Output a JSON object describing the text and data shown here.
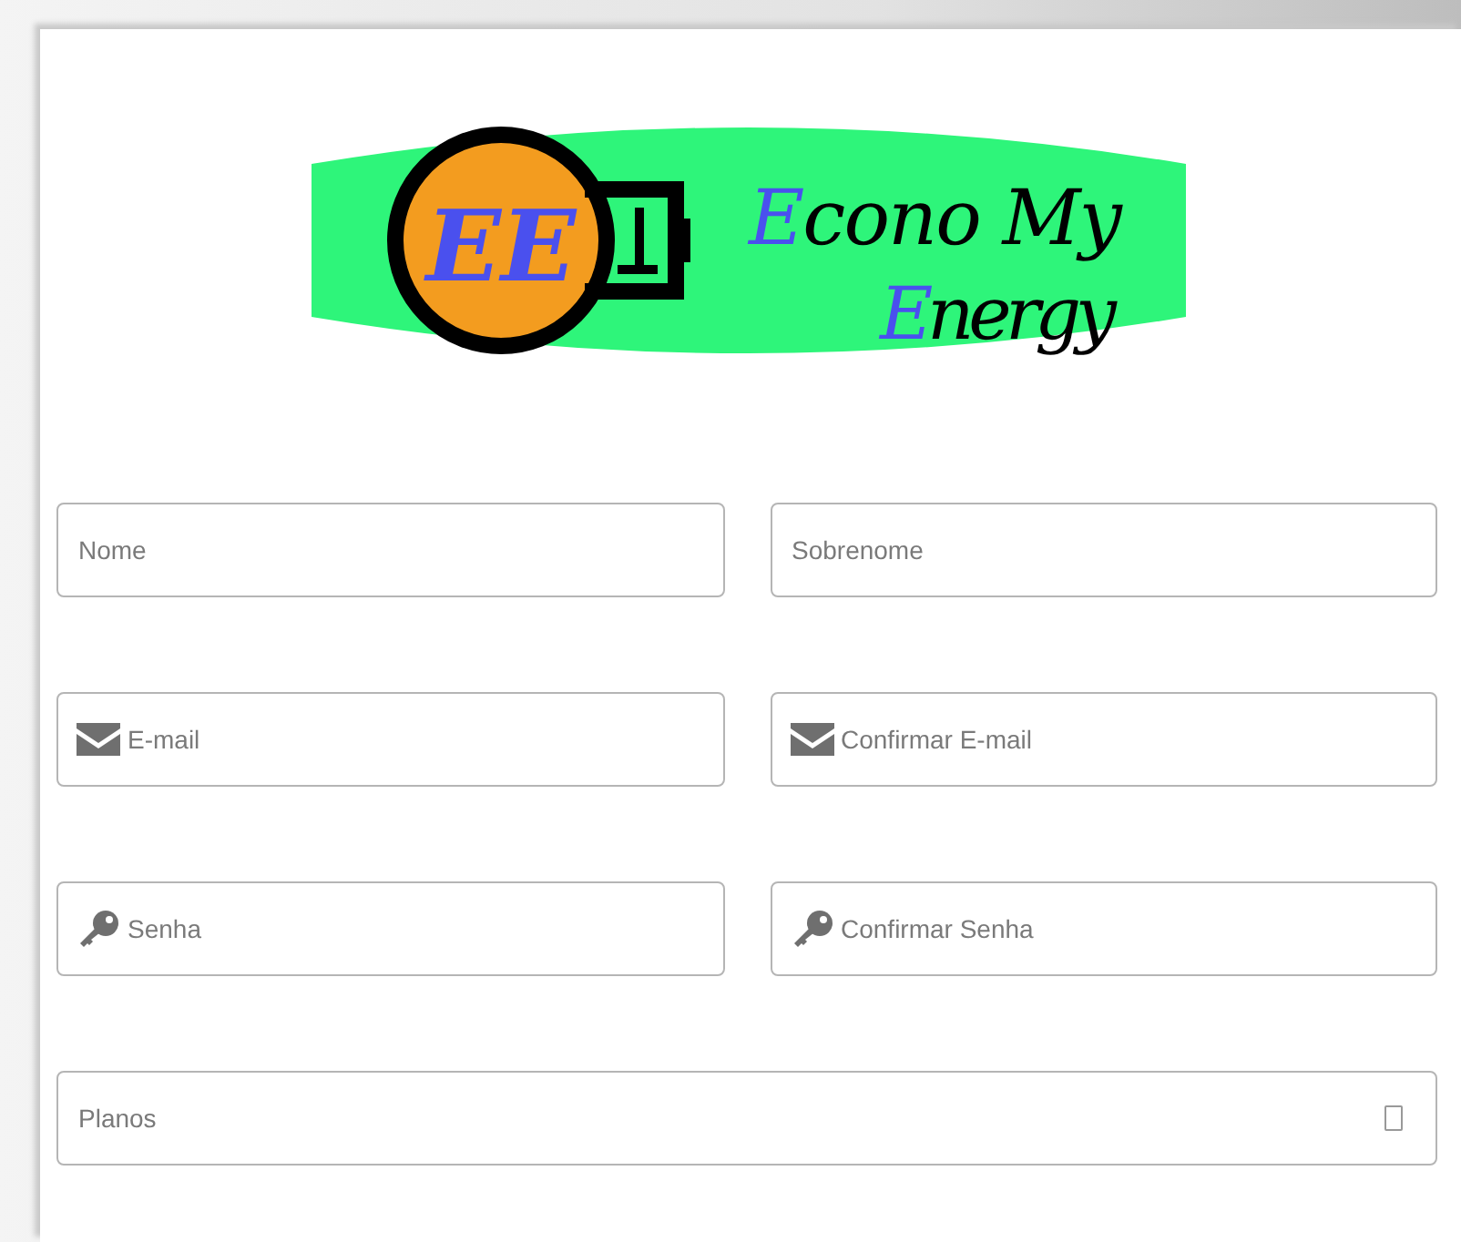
{
  "logo": {
    "monogram": "EE",
    "lines": [
      {
        "initial": "E",
        "rest": "cono My"
      },
      {
        "initial": "E",
        "rest": "nergy"
      }
    ]
  },
  "rows": [
    {
      "fields": [
        {
          "kind": "plain",
          "placeholder": "Nome"
        },
        {
          "kind": "plain",
          "placeholder": "Sobrenome"
        }
      ]
    },
    {
      "fields": [
        {
          "kind": "email",
          "placeholder": "E-mail"
        },
        {
          "kind": "email",
          "placeholder": "Confirmar E-mail"
        }
      ]
    },
    {
      "fields": [
        {
          "kind": "password",
          "placeholder": "Senha"
        },
        {
          "kind": "password",
          "placeholder": "Confirmar Senha"
        }
      ]
    },
    {
      "fields": [
        {
          "kind": "select",
          "placeholder": "Planos"
        }
      ]
    }
  ]
}
